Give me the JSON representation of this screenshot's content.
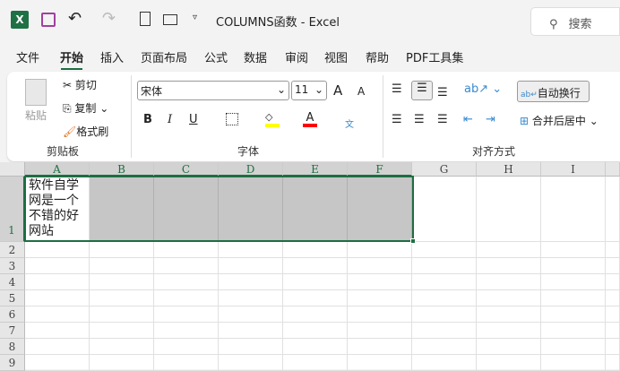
{
  "titlebar": {
    "title": "COLUMNS函数  -  Excel",
    "search_placeholder": "搜索"
  },
  "tabs": [
    "文件",
    "开始",
    "插入",
    "页面布局",
    "公式",
    "数据",
    "审阅",
    "视图",
    "帮助",
    "PDF工具集"
  ],
  "clipboard": {
    "paste": "粘贴",
    "cut": "剪切",
    "copy": "复制",
    "format_painter": "格式刷",
    "group": "剪贴板"
  },
  "font": {
    "name": "宋体",
    "size": "11",
    "bold": "B",
    "italic": "I",
    "underline": "U",
    "group": "字体",
    "grow": "A",
    "shrink": "A",
    "font_color": "A",
    "phonetic": "文"
  },
  "alignment": {
    "wrap_text": "自动换行",
    "merge_center": "合并后居中",
    "group": "对齐方式"
  },
  "sheet": {
    "columns": [
      "A",
      "B",
      "C",
      "D",
      "E",
      "F",
      "G",
      "H",
      "I"
    ],
    "rows": [
      "1",
      "2",
      "3",
      "4",
      "5",
      "6",
      "7",
      "8",
      "9"
    ],
    "a1_lines": [
      "软件自学",
      "网是一个",
      "不错的好",
      "网站"
    ]
  },
  "colors": {
    "accent": "#1e6e42",
    "fill_yellow": "#ffff00",
    "font_red": "#ff0000"
  }
}
